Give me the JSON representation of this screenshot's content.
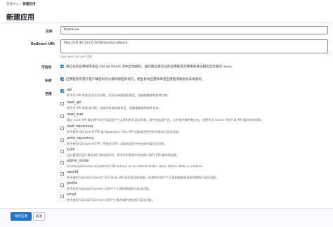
{
  "breadcrumb": {
    "items": [
      "管理中心",
      "新建应用"
    ],
    "separator": "/"
  },
  "page": {
    "title": "新建应用"
  },
  "form": {
    "name": {
      "label": "名称",
      "value": "Bytebase"
    },
    "redirect_uri": {
      "label": "Redirect URI",
      "value": "http://10.30.122.6:5678/oauth/callback",
      "help": "Use one line per URI"
    },
    "trusted": {
      "label": "可信的",
      "checked": true,
      "text": "受信任的应用程序会在 GitLab OAuth 流中自动授权。强烈建议受信任的应用程序对使用者来说都应是可靠的 issue。"
    },
    "confidential": {
      "label": "私密",
      "checked": true,
      "text": "应用程序可用于客户端密码可以保持保密的地方。原生移动应用和单页应用程序被视为非保密的。"
    },
    "scopes": {
      "label": "范围",
      "items": [
        {
          "name": "api",
          "checked": true,
          "desc": "授予对 API 的完全读写访问权，包括所有群组和项目、容器镜像库和软件包库。"
        },
        {
          "name": "read_api",
          "checked": false,
          "desc": "授予对 API 的读访问权，包括所有群组和项目、容器镜像库和软件包库。"
        },
        {
          "name": "read_user",
          "checked": false,
          "desc": "通过 /user API 端点授予对已验证用户个人资料的只读访问权，其中包括用户名、公共电子邮件和全名。还授予对 /users 下的只读 API 端点的访问权。"
        },
        {
          "name": "read_repository",
          "checked": false,
          "desc": "授予使用 Git-over-HTTP 或 Repository Files API 对私有项目中的仓库的只读访问权。"
        },
        {
          "name": "write_repository",
          "checked": false,
          "desc": "授予使用 Git-over-HTTP（不使用 API）对私有项目中的仓库的读写访问权。"
        },
        {
          "name": "sudo",
          "checked": false,
          "desc": "当以管理员用户身份进行身份验证时，授予作为系统中任何用户执行 API 操作的权限。"
        },
        {
          "name": "admin_mode",
          "checked": false,
          "desc": "Grants permission to perform API actions as an administrator, when Admin Mode is enabled."
        },
        {
          "name": "openid",
          "checked": false,
          "desc": "授予使用 OpenID Connect 向 GitLab 进行身份验证的权限。还提供对用户个人资料和群组成员资格的只读访问权。"
        },
        {
          "name": "profile",
          "checked": false,
          "desc": "授予使用 OpenID Connect 对用户个人资料数据的只读访问权。"
        },
        {
          "name": "email",
          "checked": false,
          "desc": "授予使用 OpenID Connect 对用户主电子邮件地址的只读访问权。"
        }
      ]
    }
  },
  "actions": {
    "save": "保存应用",
    "cancel": "取消"
  },
  "colors": {
    "primary": "#1f75cb",
    "text": "#333238",
    "muted": "#737278",
    "border": "#89888d"
  }
}
